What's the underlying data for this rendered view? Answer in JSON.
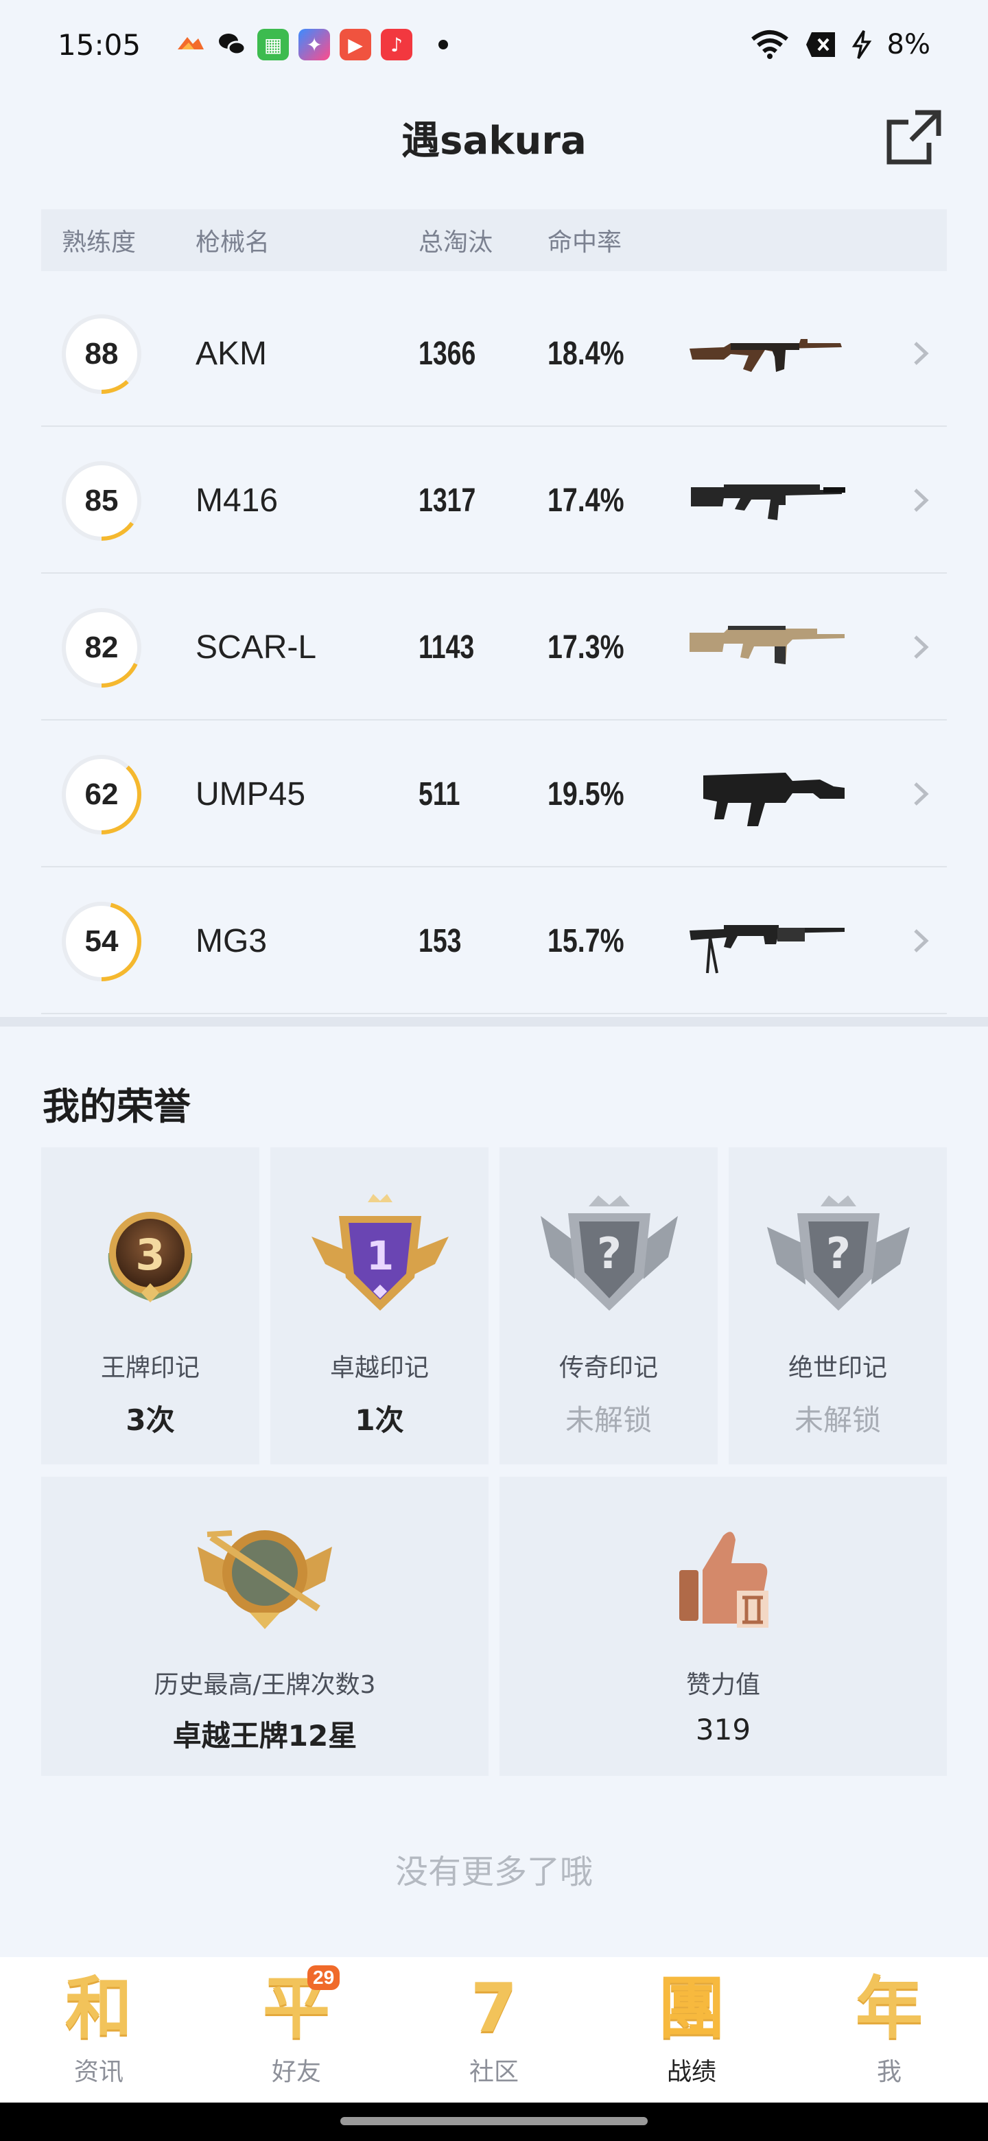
{
  "status": {
    "time": "15:05",
    "battery": "8%",
    "notif_icons": [
      "game-app-icon",
      "wechat-icon",
      "calendar-app-icon",
      "app-store-icon",
      "video-app-icon",
      "music-app-icon"
    ]
  },
  "header": {
    "title": "遇sakura"
  },
  "table": {
    "headers": {
      "mastery": "熟练度",
      "weapon": "枪械名",
      "eliminations": "总淘汰",
      "accuracy": "命中率"
    },
    "rows": [
      {
        "mastery": 88,
        "name": "AKM",
        "eliminations": "1366",
        "accuracy": "18.4%"
      },
      {
        "mastery": 85,
        "name": "M416",
        "eliminations": "1317",
        "accuracy": "17.4%"
      },
      {
        "mastery": 82,
        "name": "SCAR-L",
        "eliminations": "1143",
        "accuracy": "17.3%"
      },
      {
        "mastery": 62,
        "name": "UMP45",
        "eliminations": "511",
        "accuracy": "19.5%"
      },
      {
        "mastery": 54,
        "name": "MG3",
        "eliminations": "153",
        "accuracy": "15.7%"
      }
    ]
  },
  "honors": {
    "title": "我的荣誉",
    "cards": [
      {
        "label": "王牌印记",
        "value": "3次",
        "locked": false,
        "badge_number": "3"
      },
      {
        "label": "卓越印记",
        "value": "1次",
        "locked": false,
        "badge_number": "1"
      },
      {
        "label": "传奇印记",
        "value": "未解锁",
        "locked": true,
        "badge_number": "?"
      },
      {
        "label": "绝世印记",
        "value": "未解锁",
        "locked": true,
        "badge_number": "?"
      }
    ],
    "highest": {
      "label": "历史最高/王牌次数3",
      "value": "卓越王牌12星"
    },
    "likes": {
      "label": "赞力值",
      "value": "319"
    }
  },
  "footer_note": "没有更多了哦",
  "nav": {
    "items": [
      {
        "glyph": "和",
        "label": "资讯"
      },
      {
        "glyph": "平",
        "label": "好友",
        "badge": "29"
      },
      {
        "glyph": "7",
        "label": "社区"
      },
      {
        "glyph": "團",
        "label": "战绩",
        "active": true
      },
      {
        "glyph": "年",
        "label": "我"
      }
    ]
  },
  "colors": {
    "ring_progress": "#f5b82e",
    "ring_track": "#e9ecf1",
    "badge_gold": "#e0a34a",
    "badge_purple": "#6f4ab8"
  }
}
